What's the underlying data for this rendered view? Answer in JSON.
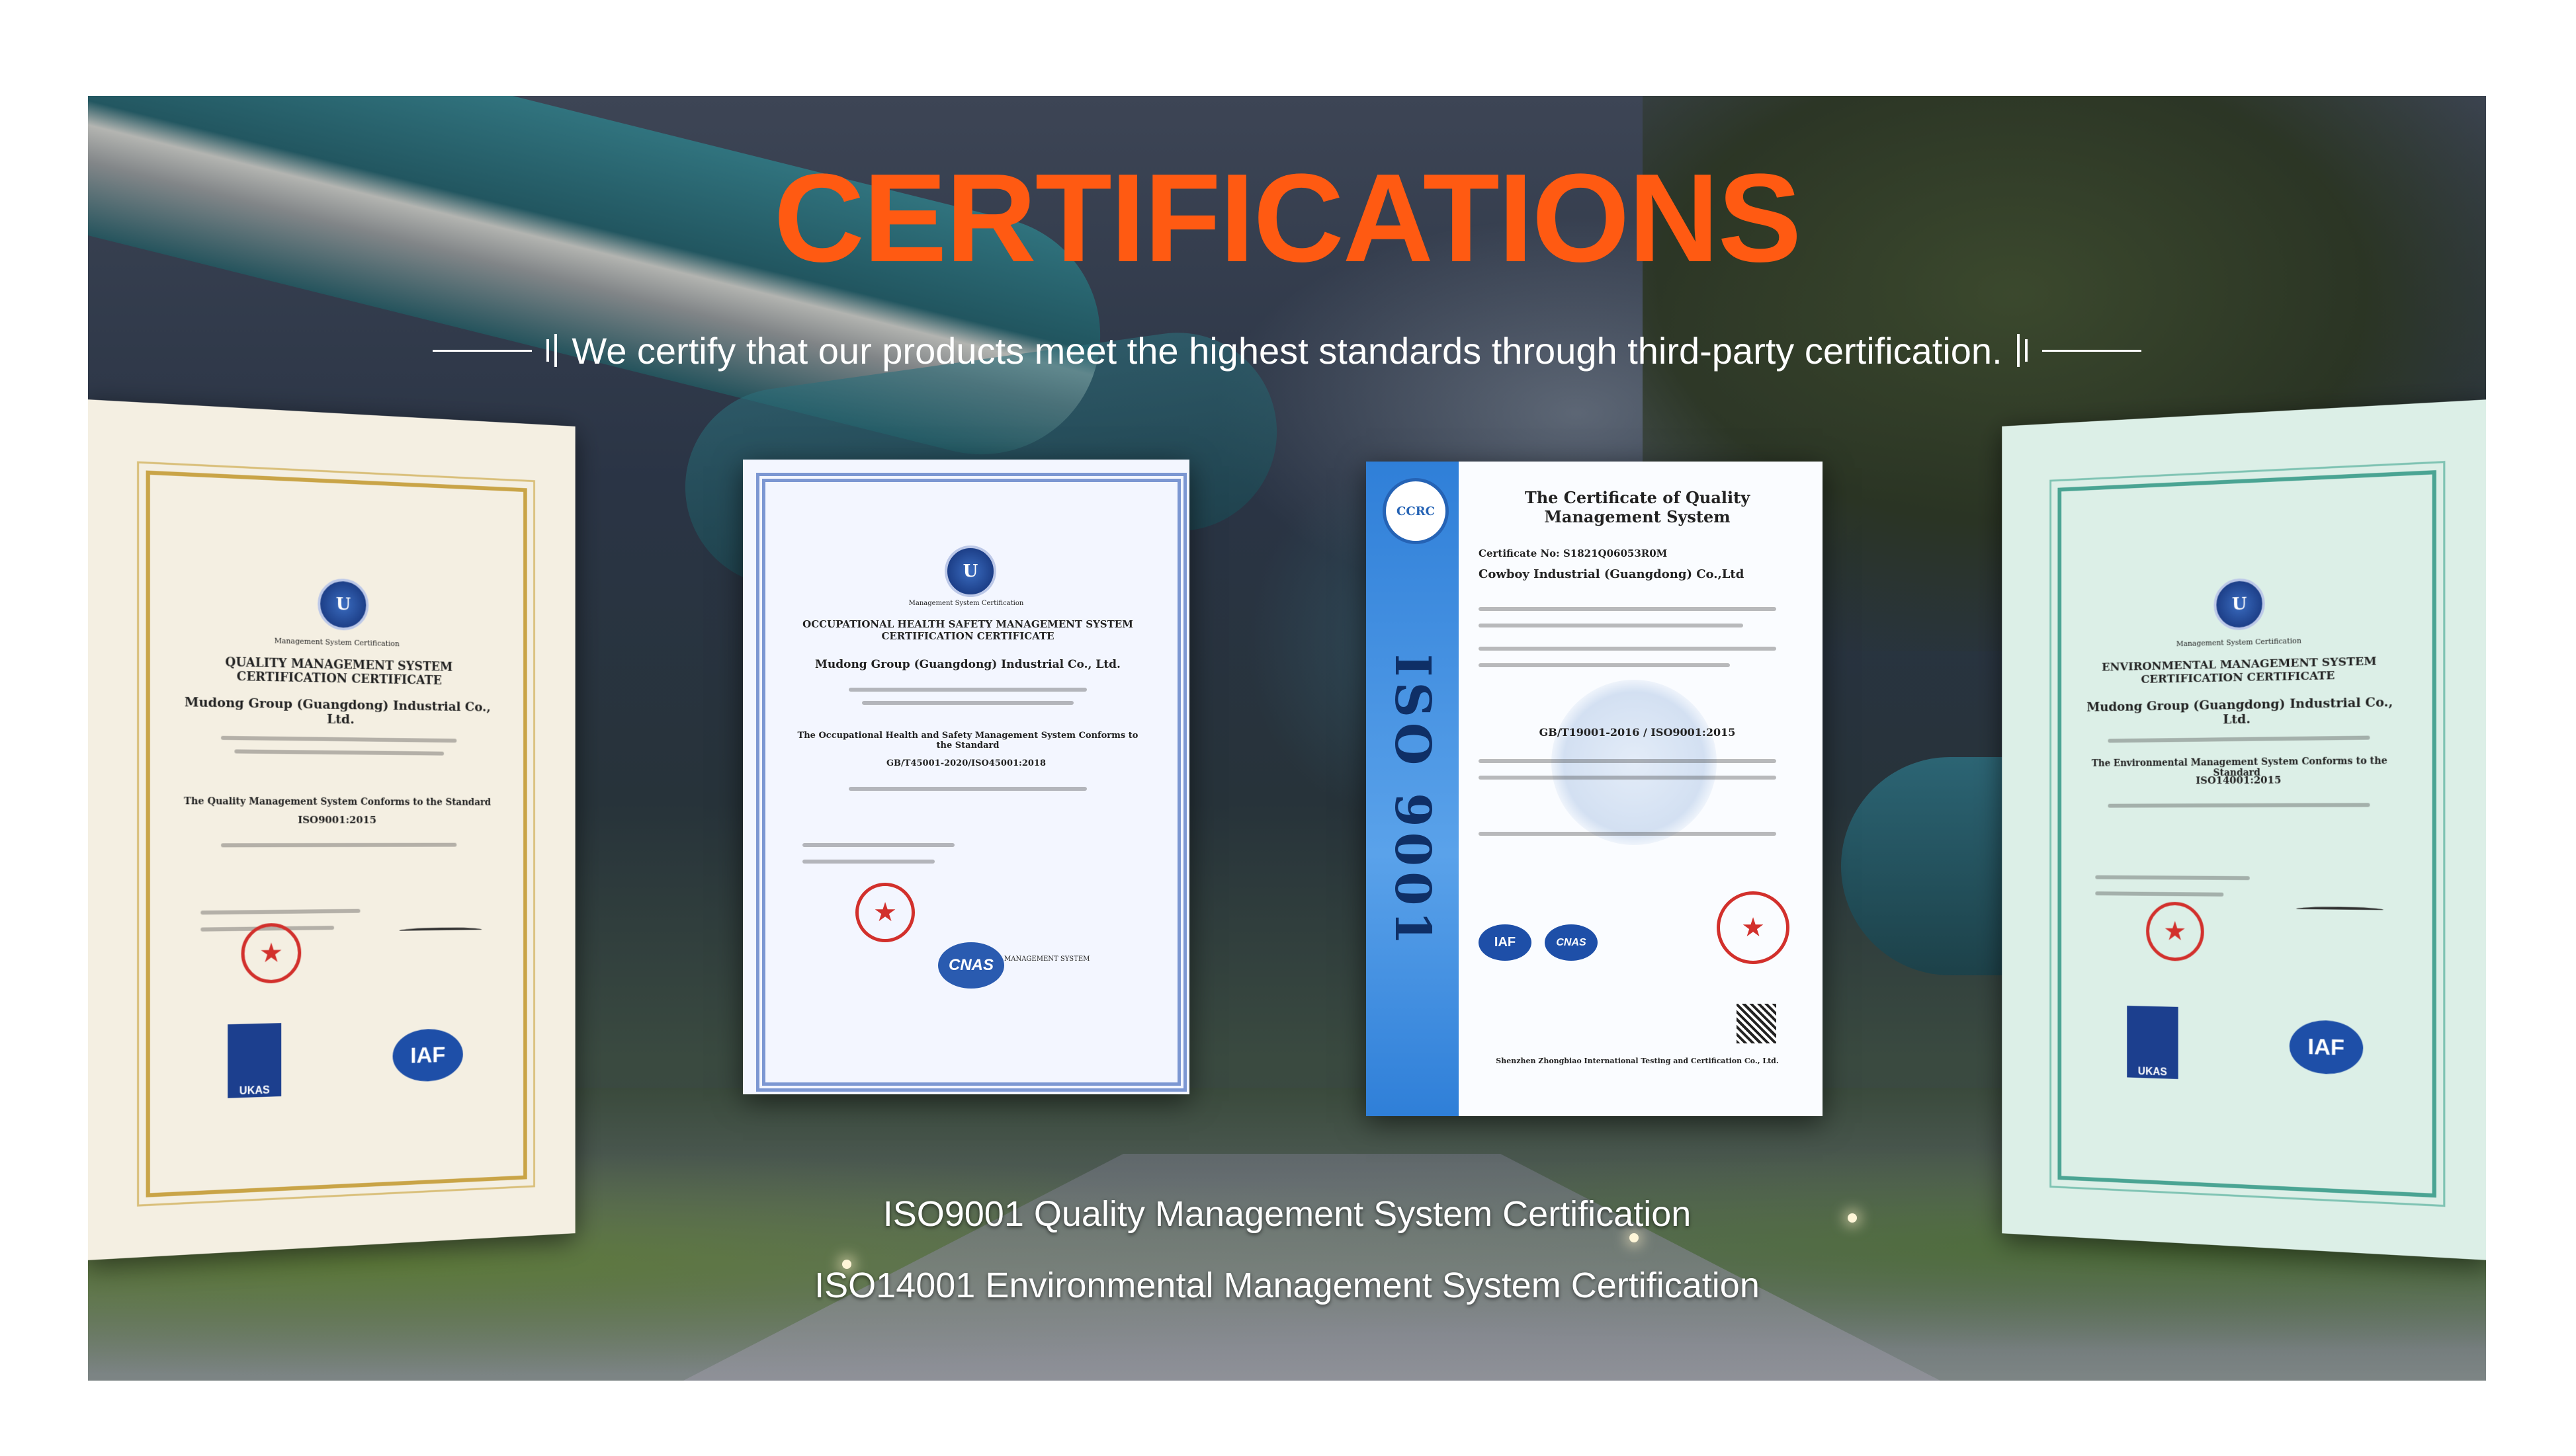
{
  "title": "CERTIFICATIONS",
  "subtitle": "We certify that our products meet the highest standards through third-party certification.",
  "colors": {
    "accent": "#ff5a12",
    "text": "#ffffff"
  },
  "certificates": [
    {
      "heading": "QUALITY MANAGEMENT SYSTEM CERTIFICATION CERTIFICATE",
      "company": "Mudong Group (Guangdong) Industrial Co., Ltd.",
      "standard": "The Quality Management System Conforms to the Standard",
      "code": "ISO9001:2015",
      "badge": "Management System Certification",
      "accreditation": "IAF",
      "ukas": "UKAS"
    },
    {
      "heading": "OCCUPATIONAL HEALTH SAFETY MANAGEMENT SYSTEM CERTIFICATION CERTIFICATE",
      "company": "Mudong Group (Guangdong) Industrial Co., Ltd.",
      "standard": "The Occupational Health and Safety Management System Conforms to the Standard",
      "code": "GB/T45001-2020/ISO45001:2018",
      "badge": "Management System Certification",
      "accreditation": "CNAS",
      "cnas_note": "MANAGEMENT SYSTEM"
    },
    {
      "heading": "The Certificate of Quality Management System",
      "cert_no": "Certificate No: S1821Q06053R0M",
      "company": "Cowboy Industrial (Guangdong) Co.,Ltd",
      "side_label": "ISO 9001",
      "code": "GB/T19001-2016 / ISO9001:2015",
      "footer": "Shenzhen Zhongbiao International Testing and Certification Co., Ltd.",
      "marks": [
        "IAF",
        "CNAS"
      ]
    },
    {
      "heading": "ENVIRONMENTAL MANAGEMENT SYSTEM CERTIFICATION CERTIFICATE",
      "company": "Mudong Group (Guangdong) Industrial Co., Ltd.",
      "standard": "The Environmental Management System Conforms to the Standard",
      "code": "ISO14001:2015",
      "badge": "Management System Certification",
      "accreditation": "IAF",
      "ukas": "UKAS"
    }
  ],
  "captions": [
    "ISO9001 Quality Management System Certification",
    "ISO14001 Environmental Management System Certification"
  ]
}
